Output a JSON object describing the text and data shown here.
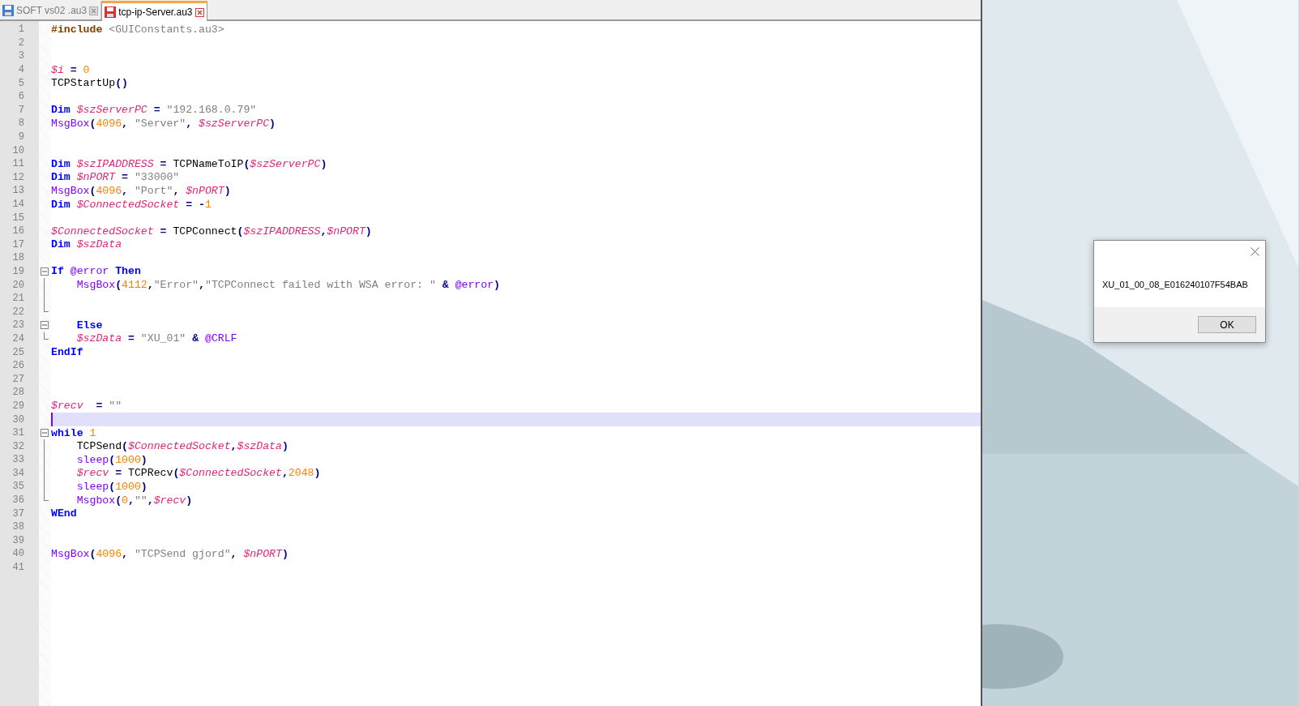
{
  "tabs": [
    {
      "label": "SOFT vs02 .au3",
      "selected": false,
      "modified": false
    },
    {
      "label": "tcp-ip-Server.au3",
      "selected": true,
      "modified": true
    }
  ],
  "editor": {
    "lines": [
      {
        "number": "1",
        "current": false,
        "kind": "plain",
        "tokens": [
          {
            "kind": "dir",
            "text": "#include"
          },
          {
            "kind": "inc",
            "text": " <GUIConstants.au3>"
          }
        ]
      },
      {
        "number": "2",
        "current": false,
        "kind": "plain"
      },
      {
        "number": "3",
        "current": false,
        "kind": "plain"
      },
      {
        "number": "4",
        "current": false,
        "kind": "plain",
        "tokens": [
          {
            "kind": "var",
            "text": "$i"
          },
          {
            "kind": "op",
            "text": " = "
          },
          {
            "kind": "num",
            "text": "0"
          }
        ]
      },
      {
        "number": "5",
        "current": false,
        "kind": "plain",
        "tokens": [
          {
            "kind": "fn",
            "text": "TCPStartUp"
          },
          {
            "kind": "op",
            "text": "()"
          }
        ]
      },
      {
        "number": "6",
        "current": false,
        "kind": "plain"
      },
      {
        "number": "7",
        "current": false,
        "kind": "plain",
        "tokens": [
          {
            "kind": "kw",
            "text": "Dim "
          },
          {
            "kind": "var",
            "text": "$szServerPC"
          },
          {
            "kind": "op",
            "text": " = "
          },
          {
            "kind": "str",
            "text": "\"192.168.0.79\""
          }
        ]
      },
      {
        "number": "8",
        "current": false,
        "kind": "plain",
        "tokens": [
          {
            "kind": "bfn",
            "text": "MsgBox"
          },
          {
            "kind": "op",
            "text": "("
          },
          {
            "kind": "num",
            "text": "4096"
          },
          {
            "kind": "op",
            "text": ", "
          },
          {
            "kind": "str",
            "text": "\"Server\""
          },
          {
            "kind": "op",
            "text": ", "
          },
          {
            "kind": "var",
            "text": "$szServerPC"
          },
          {
            "kind": "op",
            "text": ")"
          }
        ]
      },
      {
        "number": "9",
        "current": false,
        "kind": "plain"
      },
      {
        "number": "10",
        "current": false,
        "kind": "plain"
      },
      {
        "number": "11",
        "current": false,
        "kind": "plain",
        "tokens": [
          {
            "kind": "kw",
            "text": "Dim "
          },
          {
            "kind": "var",
            "text": "$szIPADDRESS"
          },
          {
            "kind": "op",
            "text": " = "
          },
          {
            "kind": "fn",
            "text": "TCPNameToIP"
          },
          {
            "kind": "op",
            "text": "("
          },
          {
            "kind": "var",
            "text": "$szServerPC"
          },
          {
            "kind": "op",
            "text": ")"
          }
        ]
      },
      {
        "number": "12",
        "current": false,
        "kind": "plain",
        "tokens": [
          {
            "kind": "kw",
            "text": "Dim "
          },
          {
            "kind": "var",
            "text": "$nPORT"
          },
          {
            "kind": "op",
            "text": " = "
          },
          {
            "kind": "str",
            "text": "\"33000\""
          }
        ]
      },
      {
        "number": "13",
        "current": false,
        "kind": "plain",
        "tokens": [
          {
            "kind": "bfn",
            "text": "MsgBox"
          },
          {
            "kind": "op",
            "text": "("
          },
          {
            "kind": "num",
            "text": "4096"
          },
          {
            "kind": "op",
            "text": ", "
          },
          {
            "kind": "str",
            "text": "\"Port\""
          },
          {
            "kind": "op",
            "text": ", "
          },
          {
            "kind": "var",
            "text": "$nPORT"
          },
          {
            "kind": "op",
            "text": ")"
          }
        ]
      },
      {
        "number": "14",
        "current": false,
        "kind": "plain",
        "tokens": [
          {
            "kind": "kw",
            "text": "Dim "
          },
          {
            "kind": "var",
            "text": "$ConnectedSocket"
          },
          {
            "kind": "op",
            "text": " = -"
          },
          {
            "kind": "num",
            "text": "1"
          }
        ]
      },
      {
        "number": "15",
        "current": false,
        "kind": "plain"
      },
      {
        "number": "16",
        "current": false,
        "kind": "plain",
        "tokens": [
          {
            "kind": "var",
            "text": "$ConnectedSocket"
          },
          {
            "kind": "op",
            "text": " = "
          },
          {
            "kind": "fn",
            "text": "TCPConnect"
          },
          {
            "kind": "op",
            "text": "("
          },
          {
            "kind": "var",
            "text": "$szIPADDRESS"
          },
          {
            "kind": "op",
            "text": ","
          },
          {
            "kind": "var",
            "text": "$nPORT"
          },
          {
            "kind": "op",
            "text": ")"
          }
        ]
      },
      {
        "number": "17",
        "current": false,
        "kind": "plain",
        "tokens": [
          {
            "kind": "kw",
            "text": "Dim "
          },
          {
            "kind": "var",
            "text": "$szData"
          }
        ]
      },
      {
        "number": "18",
        "current": false,
        "kind": "plain"
      },
      {
        "number": "19",
        "current": false,
        "kind": "fold_start",
        "tokens": [
          {
            "kind": "kw",
            "text": "If "
          },
          {
            "kind": "mac",
            "text": "@error"
          },
          {
            "kind": "kw",
            "text": " Then"
          }
        ]
      },
      {
        "number": "20",
        "current": false,
        "kind": "fold_body",
        "tokens": [
          {
            "kind": "bfn",
            "text": "    MsgBox"
          },
          {
            "kind": "op",
            "text": "("
          },
          {
            "kind": "num",
            "text": "4112"
          },
          {
            "kind": "op",
            "text": ","
          },
          {
            "kind": "str",
            "text": "\"Error\""
          },
          {
            "kind": "op",
            "text": ","
          },
          {
            "kind": "str",
            "text": "\"TCPConnect failed with WSA error: \""
          },
          {
            "kind": "op",
            "text": " & "
          },
          {
            "kind": "mac",
            "text": "@error"
          },
          {
            "kind": "op",
            "text": ")"
          }
        ]
      },
      {
        "number": "21",
        "current": false,
        "kind": "fold_body"
      },
      {
        "number": "22",
        "current": false,
        "kind": "fold_end"
      },
      {
        "number": "23",
        "current": false,
        "kind": "fold_start",
        "tokens": [
          {
            "kind": "kw",
            "text": "    Else"
          }
        ]
      },
      {
        "number": "24",
        "current": false,
        "kind": "fold_end",
        "tokens": [
          {
            "kind": "var",
            "text": "    $szData"
          },
          {
            "kind": "op",
            "text": " = "
          },
          {
            "kind": "str",
            "text": "\"XU_01\""
          },
          {
            "kind": "op",
            "text": " & "
          },
          {
            "kind": "mac",
            "text": "@CRLF"
          }
        ]
      },
      {
        "number": "25",
        "current": false,
        "kind": "plain",
        "tokens": [
          {
            "kind": "kw",
            "text": "EndIf"
          }
        ]
      },
      {
        "number": "26",
        "current": false,
        "kind": "plain"
      },
      {
        "number": "27",
        "current": false,
        "kind": "plain"
      },
      {
        "number": "28",
        "current": false,
        "kind": "plain"
      },
      {
        "number": "29",
        "current": false,
        "kind": "plain",
        "tokens": [
          {
            "kind": "var",
            "text": "$recv"
          },
          {
            "kind": "op",
            "text": "  = "
          },
          {
            "kind": "str",
            "text": "\"\""
          }
        ]
      },
      {
        "number": "30",
        "current": true,
        "kind": "plain"
      },
      {
        "number": "31",
        "current": false,
        "kind": "fold_start",
        "tokens": [
          {
            "kind": "kw",
            "text": "while "
          },
          {
            "kind": "num",
            "text": "1"
          }
        ]
      },
      {
        "number": "32",
        "current": false,
        "kind": "fold_body",
        "tokens": [
          {
            "kind": "fn",
            "text": "    TCPSend"
          },
          {
            "kind": "op",
            "text": "("
          },
          {
            "kind": "var",
            "text": "$ConnectedSocket"
          },
          {
            "kind": "op",
            "text": ","
          },
          {
            "kind": "var",
            "text": "$szData"
          },
          {
            "kind": "op",
            "text": ")"
          }
        ]
      },
      {
        "number": "33",
        "current": false,
        "kind": "fold_body",
        "tokens": [
          {
            "kind": "bfn",
            "text": "    sleep"
          },
          {
            "kind": "op",
            "text": "("
          },
          {
            "kind": "num",
            "text": "1000"
          },
          {
            "kind": "op",
            "text": ")"
          }
        ]
      },
      {
        "number": "34",
        "current": false,
        "kind": "fold_body",
        "tokens": [
          {
            "kind": "var",
            "text": "    $recv"
          },
          {
            "kind": "op",
            "text": " = "
          },
          {
            "kind": "fn",
            "text": "TCPRecv"
          },
          {
            "kind": "op",
            "text": "("
          },
          {
            "kind": "var",
            "text": "$ConnectedSocket"
          },
          {
            "kind": "op",
            "text": ","
          },
          {
            "kind": "num",
            "text": "2048"
          },
          {
            "kind": "op",
            "text": ")"
          }
        ]
      },
      {
        "number": "35",
        "current": false,
        "kind": "fold_body",
        "tokens": [
          {
            "kind": "bfn",
            "text": "    sleep"
          },
          {
            "kind": "op",
            "text": "("
          },
          {
            "kind": "num",
            "text": "1000"
          },
          {
            "kind": "op",
            "text": ")"
          }
        ]
      },
      {
        "number": "36",
        "current": false,
        "kind": "fold_end",
        "tokens": [
          {
            "kind": "bfn",
            "text": "    Msgbox"
          },
          {
            "kind": "op",
            "text": "("
          },
          {
            "kind": "num",
            "text": "0"
          },
          {
            "kind": "op",
            "text": ","
          },
          {
            "kind": "str",
            "text": "\"\""
          },
          {
            "kind": "op",
            "text": ","
          },
          {
            "kind": "var",
            "text": "$recv"
          },
          {
            "kind": "op",
            "text": ")"
          }
        ]
      },
      {
        "number": "37",
        "current": false,
        "kind": "plain",
        "tokens": [
          {
            "kind": "kw",
            "text": "WEnd"
          }
        ]
      },
      {
        "number": "38",
        "current": false,
        "kind": "plain"
      },
      {
        "number": "39",
        "current": false,
        "kind": "plain"
      },
      {
        "number": "40",
        "current": false,
        "kind": "plain",
        "tokens": [
          {
            "kind": "bfn",
            "text": "MsgBox"
          },
          {
            "kind": "op",
            "text": "("
          },
          {
            "kind": "num",
            "text": "4096"
          },
          {
            "kind": "op",
            "text": ", "
          },
          {
            "kind": "str",
            "text": "\"TCPSend gjord\""
          },
          {
            "kind": "op",
            "text": ", "
          },
          {
            "kind": "var",
            "text": "$nPORT"
          },
          {
            "kind": "op",
            "text": ")"
          }
        ]
      },
      {
        "number": "41",
        "current": false,
        "kind": "plain"
      }
    ]
  },
  "dialog": {
    "message": "XU_01_00_08_E016240107F54BAB",
    "button": "OK"
  }
}
